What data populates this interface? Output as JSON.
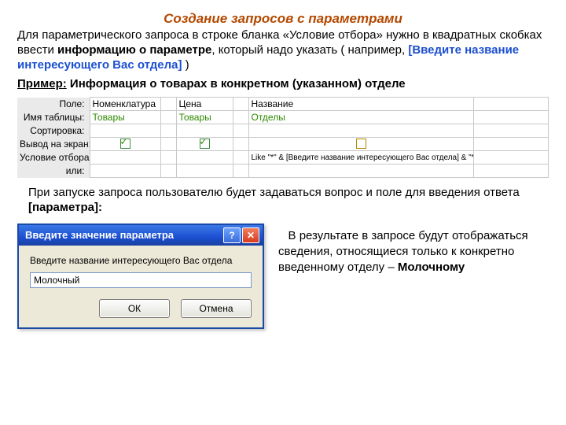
{
  "title": "Создание  запросов  с параметрами",
  "intro": {
    "p1a": "Для параметрического запроса в строке бланка «Условие отбора» нужно в квадратных скобках ввести ",
    "p1b_bold": "информацию о параметре",
    "p1c": ", который надо указать ( например, ",
    "p1_bracket": "[Введите название интересующего Вас отдела]",
    "p1d": " )",
    "p2_label": "Пример:",
    "p2_text": " Информация о товарах в конкретном (указанном) отделе"
  },
  "grid": {
    "labels": {
      "field": "Поле:",
      "table": "Имя таблицы:",
      "sort": "Сортировка:",
      "show": "Вывод на экран:",
      "criteria": "Условие отбора:",
      "or": "или:"
    },
    "cols": [
      {
        "field": "Номенклатура",
        "table": "Товары",
        "show": true,
        "criteria": ""
      },
      {
        "field": "Цена",
        "table": "Товары",
        "show": true,
        "criteria": ""
      },
      {
        "field": "Название",
        "table": "Отделы",
        "show": false,
        "criteria": "Like \"*\" & [Введите название интересующего Вас отдела] & \"*\""
      }
    ]
  },
  "mid": {
    "a": "При запуске запроса пользователю будет задаваться вопрос и поле для введения ответа ",
    "b": "[параметра]:"
  },
  "dialog": {
    "title": "Введите значение параметра",
    "help": "?",
    "close": "✕",
    "label": "Введите название интересующего Вас отдела",
    "value": "Молочный",
    "ok": "ОК",
    "cancel": "Отмена"
  },
  "result": {
    "a": "В результате в запросе будут отображаться сведения, относящиеся только к конкретно введенному отделу – ",
    "b": "Молочному"
  }
}
